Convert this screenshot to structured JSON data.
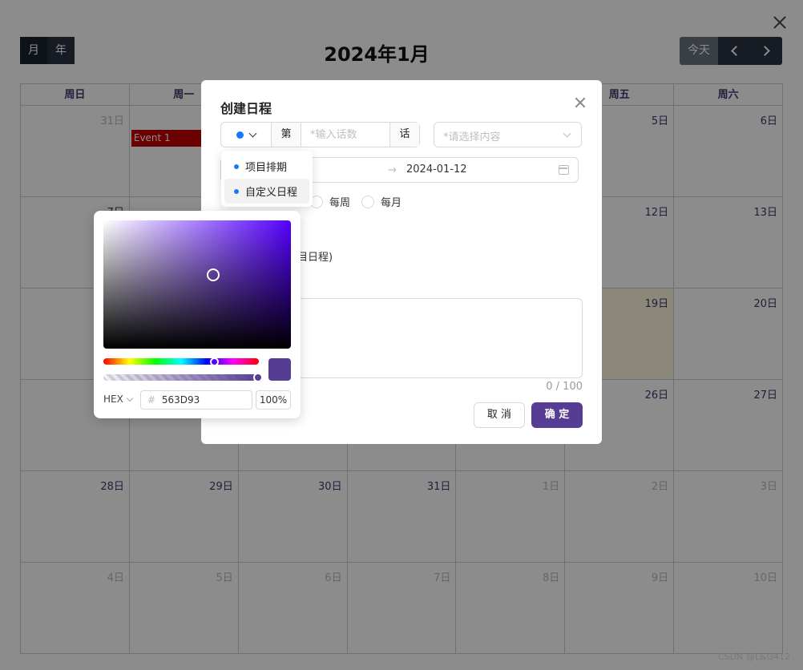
{
  "calendar": {
    "title": "2024年1月",
    "view_toggle": [
      "月",
      "年"
    ],
    "today_label": "今天",
    "weekdays": [
      "周日",
      "周一",
      "周二",
      "周三",
      "周四",
      "周五",
      "周六"
    ],
    "weeks": [
      [
        "31日",
        "",
        "",
        "",
        "",
        "5日",
        "6日"
      ],
      [
        "7日",
        "",
        "",
        "",
        "",
        "12日",
        "13日"
      ],
      [
        "",
        "",
        "",
        "",
        "",
        "19日",
        "20日"
      ],
      [
        "",
        "",
        "",
        "",
        "",
        "26日",
        "27日"
      ],
      [
        "28日",
        "29日",
        "30日",
        "31日",
        "1日",
        "2日",
        "3日"
      ],
      [
        "4日",
        "5日",
        "6日",
        "7日",
        "8日",
        "9日",
        "10日"
      ]
    ],
    "event_label": "Event 1",
    "highlight_color": "#fdf6dd",
    "event_color": "#c40000"
  },
  "modal": {
    "title": "创建日程",
    "episode_prefix": "第",
    "episode_placeholder": "*输入话数",
    "episode_suffix": "话",
    "select_placeholder": "*请选择内容",
    "date_end": "2024-01-12",
    "repeat_options": [
      "每周",
      "每月"
    ],
    "project_text": "目日程)",
    "counter": "0 / 100",
    "cancel_label": "取 消",
    "ok_label": "确 定",
    "accent_color": "#563D93",
    "dot_color": "#1677ff"
  },
  "dropdown": {
    "items": [
      "项目排期",
      "自定义日程"
    ],
    "selected": "自定义日程"
  },
  "color_picker": {
    "format": "HEX",
    "hex_value": "563D93",
    "alpha": "100%",
    "alpha_value": 1.0,
    "color": "#563D93"
  },
  "watermark": "CSDN @L&G412"
}
